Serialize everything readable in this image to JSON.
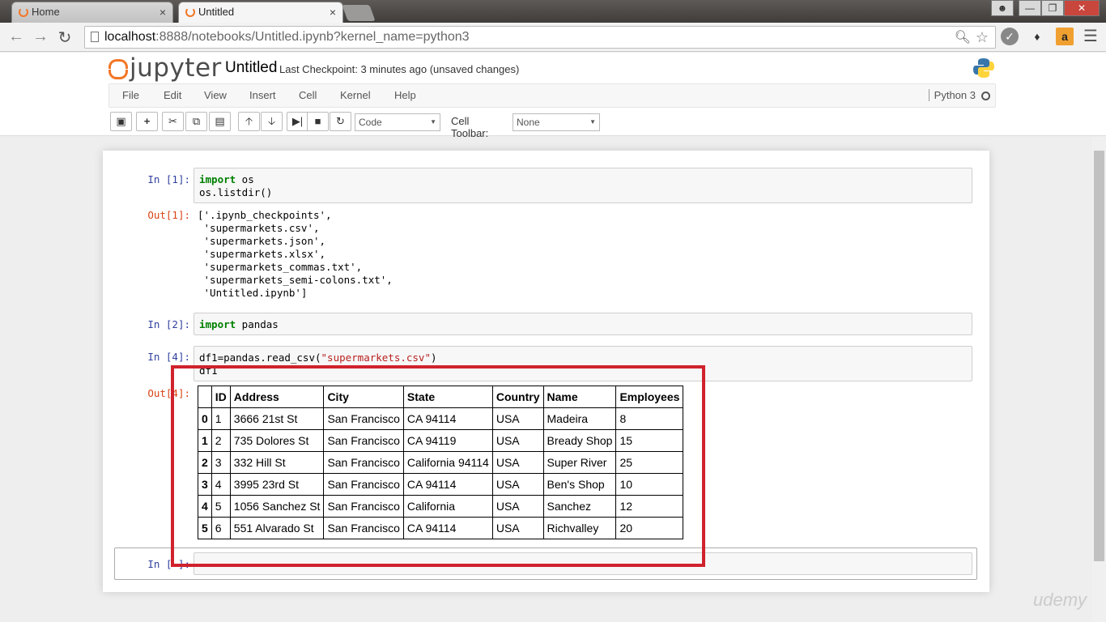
{
  "browser": {
    "tabs": [
      {
        "label": "Home",
        "active": false
      },
      {
        "label": "Untitled",
        "active": true
      }
    ],
    "close_glyph": "×",
    "url_host": "localhost",
    "url_rest": ":8888/notebooks/Untitled.ipynb?kernel_name=python3",
    "extension_badge": "a"
  },
  "jupyter": {
    "logo_text": "jupyter",
    "notebook_name": "Untitled",
    "checkpoint": "Last Checkpoint: 3 minutes ago (unsaved changes)",
    "menu": [
      "File",
      "Edit",
      "View",
      "Insert",
      "Cell",
      "Kernel",
      "Help"
    ],
    "kernel_name": "Python 3",
    "cell_type": "Code",
    "cell_toolbar_label": "Cell Toolbar:",
    "cell_toolbar_value": "None"
  },
  "cells": {
    "c1": {
      "prompt": "In [1]:",
      "line1_kw": "import",
      "line1_rest": " os",
      "line2": "os.listdir()"
    },
    "o1": {
      "prompt": "Out[1]:",
      "text": "['.ipynb_checkpoints',\n 'supermarkets.csv',\n 'supermarkets.json',\n 'supermarkets.xlsx',\n 'supermarkets_commas.txt',\n 'supermarkets_semi-colons.txt',\n 'Untitled.ipynb']"
    },
    "c2": {
      "prompt": "In [2]:",
      "kw": "import",
      "rest": " pandas"
    },
    "c4": {
      "prompt": "In [4]:",
      "pre": "df1=pandas.read_csv(",
      "str": "\"supermarkets.csv\"",
      "post": ")",
      "line2": "df1"
    },
    "o4": {
      "prompt": "Out[4]:"
    },
    "c5": {
      "prompt": "In [ ]:"
    }
  },
  "dataframe": {
    "columns": [
      "",
      "ID",
      "Address",
      "City",
      "State",
      "Country",
      "Name",
      "Employees"
    ],
    "rows": [
      [
        "0",
        "1",
        "3666 21st St",
        "San Francisco",
        "CA 94114",
        "USA",
        "Madeira",
        "8"
      ],
      [
        "1",
        "2",
        "735 Dolores St",
        "San Francisco",
        "CA 94119",
        "USA",
        "Bready Shop",
        "15"
      ],
      [
        "2",
        "3",
        "332 Hill St",
        "San Francisco",
        "California 94114",
        "USA",
        "Super River",
        "25"
      ],
      [
        "3",
        "4",
        "3995 23rd St",
        "San Francisco",
        "CA 94114",
        "USA",
        "Ben's Shop",
        "10"
      ],
      [
        "4",
        "5",
        "1056 Sanchez St",
        "San Francisco",
        "California",
        "USA",
        "Sanchez",
        "12"
      ],
      [
        "5",
        "6",
        "551 Alvarado St",
        "San Francisco",
        "CA 94114",
        "USA",
        "Richvalley",
        "20"
      ]
    ]
  },
  "watermark": "udemy",
  "colors": {
    "accent_orange": "#f37626",
    "highlight_red": "#d0222d",
    "prompt_in": "#303f9f",
    "prompt_out": "#d84315"
  }
}
